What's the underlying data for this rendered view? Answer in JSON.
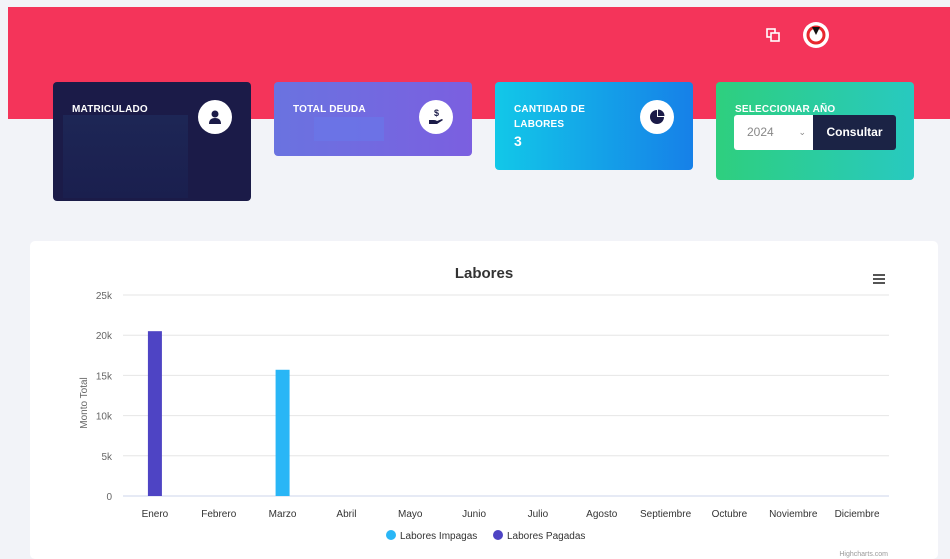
{
  "cards": {
    "matriculado": {
      "title": "MATRICULADO"
    },
    "total_deuda": {
      "title": "TOTAL DEUDA"
    },
    "cantidad": {
      "title_line1": "CANTIDAD DE",
      "title_line2": "LABORES",
      "value": "3"
    },
    "seleccionar": {
      "title": "SELECCIONAR AÑO",
      "year": "2024",
      "button": "Consultar"
    }
  },
  "colors": {
    "header": "#f4345a",
    "impagas": "#29b6f6",
    "pagadas": "#4e44c4"
  },
  "chart_data": {
    "type": "bar",
    "title": "Labores",
    "ylabel": "Monto Total",
    "categories": [
      "Enero",
      "Febrero",
      "Marzo",
      "Abril",
      "Mayo",
      "Junio",
      "Julio",
      "Agosto",
      "Septiembre",
      "Octubre",
      "Noviembre",
      "Diciembre"
    ],
    "yticks": [
      "0",
      "5k",
      "10k",
      "15k",
      "20k",
      "25k"
    ],
    "ylim": [
      0,
      25000
    ],
    "series": [
      {
        "name": "Labores Impagas",
        "values": [
          0,
          0,
          15700,
          0,
          0,
          0,
          0,
          0,
          0,
          0,
          0,
          0
        ],
        "color": "#29b6f6"
      },
      {
        "name": "Labores Pagadas",
        "values": [
          20500,
          0,
          0,
          0,
          0,
          0,
          0,
          0,
          0,
          0,
          0,
          0
        ],
        "color": "#4e44c4"
      }
    ],
    "credits": "Highcharts.com",
    "legend": "bottom-center",
    "grid": true
  }
}
